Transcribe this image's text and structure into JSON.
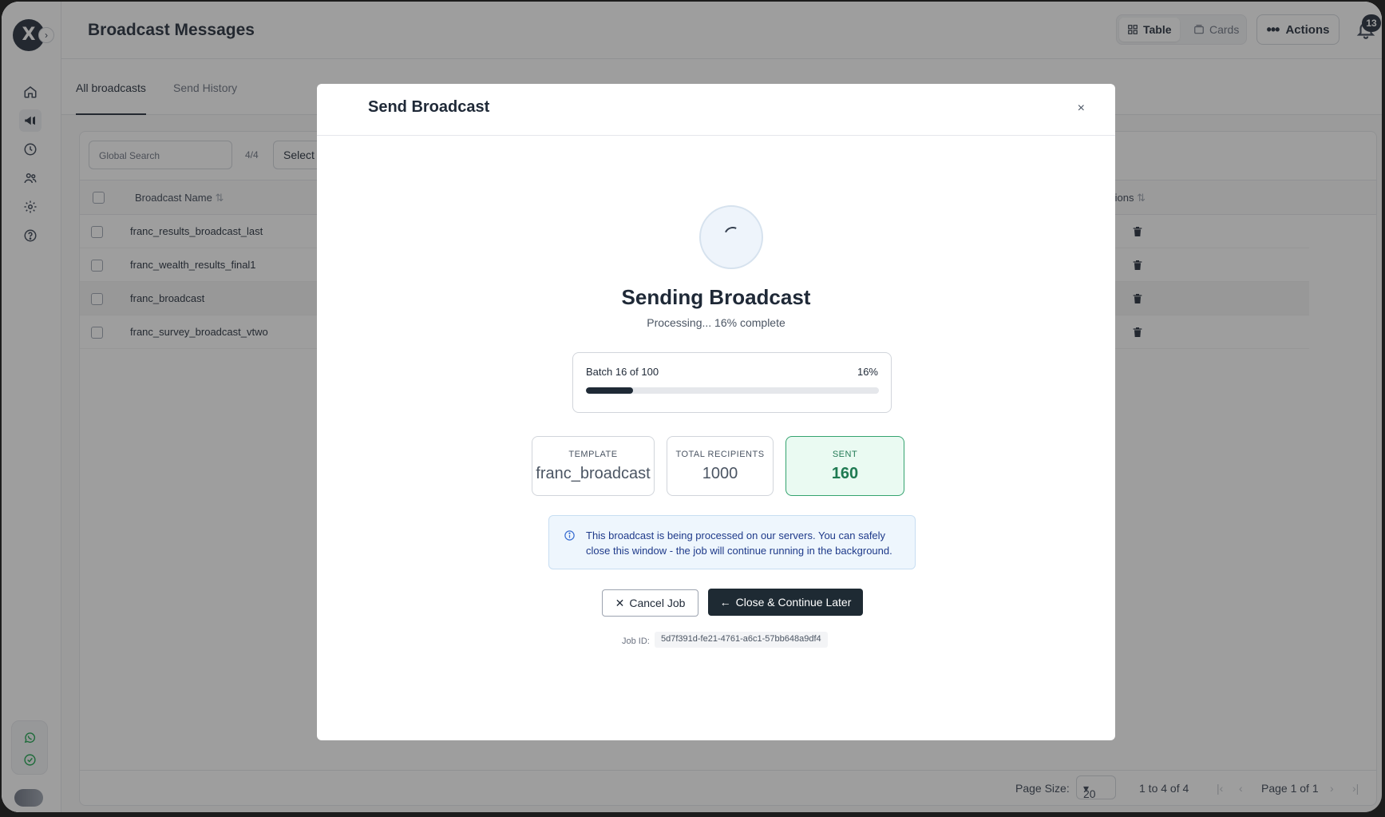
{
  "app": {
    "logo_text": "X",
    "page_title": "Broadcast Messages",
    "view_toggle": {
      "table_label": "Table",
      "cards_label": "Cards"
    },
    "actions_label": "Actions",
    "notification_count": "13"
  },
  "tabs": [
    {
      "label": "All broadcasts",
      "active": true
    },
    {
      "label": "Send History",
      "active": false
    }
  ],
  "toolbar": {
    "search_placeholder": "Global Search",
    "count": "4/4",
    "select_label": "Select"
  },
  "table": {
    "columns": {
      "name": "Broadcast Name",
      "actions": "tions"
    },
    "rows": [
      {
        "name": "franc_results_broadcast_last"
      },
      {
        "name": "franc_wealth_results_final1"
      },
      {
        "name": "franc_broadcast"
      },
      {
        "name": "franc_survey_broadcast_vtwo"
      }
    ]
  },
  "footer": {
    "page_size_label": "Page Size:",
    "page_size_value": "20",
    "range": "1 to 4 of 4",
    "page": "Page 1 of 1"
  },
  "modal": {
    "title": "Send Broadcast",
    "close_symbol": "×",
    "status_title": "Sending Broadcast",
    "status_subtitle": "Processing... 16% complete",
    "batch_label": "Batch 16 of 100",
    "batch_percent_text": "16%",
    "progress_fraction": 0.16,
    "stats": {
      "template": {
        "label": "TEMPLATE",
        "value": "franc_broadcast"
      },
      "recipients": {
        "label": "TOTAL RECIPIENTS",
        "value": "1000"
      },
      "sent": {
        "label": "SENT",
        "value": "160"
      }
    },
    "info_text": "This broadcast is being processed on our servers. You can safely close this window - the job will continue running in the background.",
    "cancel_label": "Cancel Job",
    "close_continue_label": "Close & Continue Later",
    "job_id_label": "Job ID:",
    "job_id_value": "5d7f391d-fe21-4761-a6c1-57bb648a9df4"
  },
  "colors": {
    "primary_dark": "#1e2a33",
    "sent_green": "#1f7a52",
    "info_blue": "#1e3a8a"
  }
}
